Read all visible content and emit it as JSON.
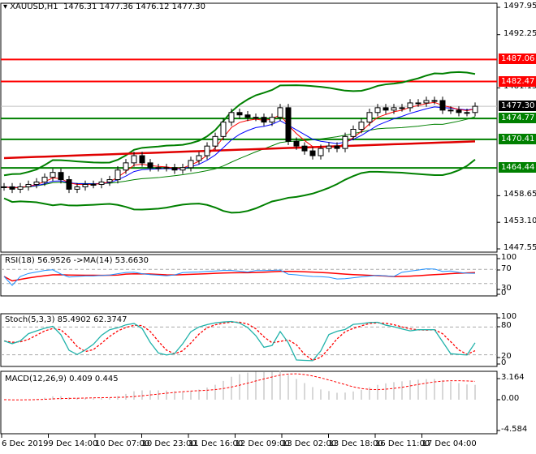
{
  "header": {
    "symbol": "XAUUSD,H1",
    "ohlc": "1476.31 1477.36 1476.12 1477.30"
  },
  "price_scale": [
    "1497.95",
    "1492.25",
    "1481.15",
    "1458.65",
    "1453.10",
    "1447.55"
  ],
  "levels": [
    {
      "label": "1487.06",
      "value": 1487.06,
      "color": "#ff0000"
    },
    {
      "label": "1482.47",
      "value": 1482.47,
      "color": "#ff0000"
    },
    {
      "label": "1474.77",
      "value": 1474.77,
      "color": "#008000"
    },
    {
      "label": "1470.41",
      "value": 1470.41,
      "color": "#008000"
    },
    {
      "label": "1464.44",
      "value": 1464.44,
      "color": "#008000"
    }
  ],
  "current_price": {
    "label": "1477.30",
    "value": 1477.3
  },
  "rsi": {
    "title": "RSI(18) 56.9526  ->MA(14) 53.6630",
    "scale": [
      "100",
      "70",
      "30",
      "0"
    ]
  },
  "stoch": {
    "title": "Stoch(5,3,3) 85.4902 62.3747",
    "scale": [
      "100",
      "80",
      "20",
      "0"
    ]
  },
  "macd": {
    "title": "MACD(12,26,9) 0.409 0.445",
    "scale": [
      "3.164",
      "0.00",
      "-4.584"
    ]
  },
  "time_axis": [
    "6 Dec 2019",
    "9 Dec 14:00",
    "10 Dec 07:00",
    "10 Dec 23:00",
    "11 Dec 16:00",
    "12 Dec 09:00",
    "13 Dec 02:00",
    "13 Dec 18:00",
    "16 Dec 11:00",
    "17 Dec 04:00"
  ],
  "chart_data": {
    "type": "line",
    "title": "XAUUSD,H1",
    "ylim": [
      1447.55,
      1497.95
    ],
    "closes": [
      1460.5,
      1460,
      1460.5,
      1461,
      1461.5,
      1462.5,
      1463.5,
      1462,
      1460,
      1460.5,
      1461,
      1461,
      1461.5,
      1462,
      1464,
      1465.5,
      1467,
      1465.5,
      1464.5,
      1464.5,
      1464.5,
      1464,
      1464.5,
      1466,
      1467,
      1469,
      1471,
      1474,
      1476,
      1475.5,
      1475,
      1475,
      1474,
      1475,
      1477,
      1470,
      1469,
      1468,
      1467,
      1468.5,
      1469,
      1468.5,
      1471,
      1472.5,
      1474,
      1476,
      1477,
      1476.5,
      1477,
      1477,
      1478,
      1478,
      1478.5,
      1478.5,
      1476.5,
      1476.5,
      1476,
      1476,
      1477.3
    ]
  }
}
